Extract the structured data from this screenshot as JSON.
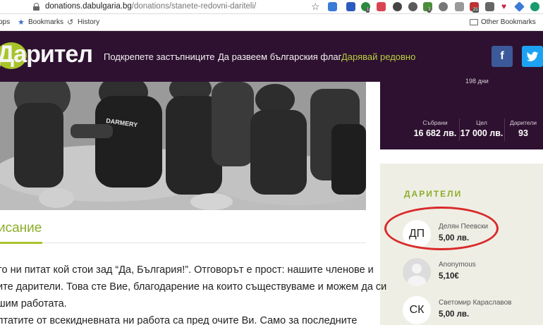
{
  "browser": {
    "url_domain": "donations.dabulgaria.bg",
    "url_path": "/donations/stanete-redovni-dariteli/",
    "extension_badges": [
      "1",
      "3",
      "21"
    ]
  },
  "bookmarks_bar": {
    "apps_label": "pps",
    "bookmarks_label": "Bookmarks",
    "history_label": "History",
    "other_bookmarks_label": "Other Bookmarks"
  },
  "site": {
    "logo_text": "Дарител",
    "nav": [
      {
        "label": "Подкрепете застъпниците"
      },
      {
        "label": "Да развеем българския флаг"
      },
      {
        "label": "Дарявай редовно"
      }
    ],
    "social": {
      "facebook_label": "f",
      "twitter_label": "t"
    },
    "colors": {
      "header_bg": "#2e1130",
      "accent": "#a8c42a",
      "panel_bg": "#efeee5",
      "highlight": "#d92a2a"
    }
  },
  "stats": {
    "days_text": "198 дни",
    "items": [
      {
        "label": "Събрани",
        "value": "16 682 лв."
      },
      {
        "label": "Цел",
        "value": "17 000 лв."
      },
      {
        "label": "Дарители",
        "value": "93"
      }
    ]
  },
  "donors": {
    "title": "ДАРИТЕЛИ",
    "items": [
      {
        "initials": "ДП",
        "name": "Делян Пеевски",
        "amount": "5,00 лв."
      },
      {
        "initials": "",
        "name": "Anonymous",
        "amount": "5,10€"
      },
      {
        "initials": "СК",
        "name": "Светомир Караславов",
        "amount": "5,00 лв."
      }
    ]
  },
  "hero": {
    "vest_text": "DARMERY"
  },
  "description": {
    "title": "исание",
    "lines": [
      "то ни питат кой стои зад “Да, България!”. Отговорът е прост: нашите членове и",
      "ите дарители. Това сте Вие, благодарение на които съществуваме и можем да си",
      "шим работата.",
      "лтатите от всекидневната ни работа са пред очите Ви. Само за последните"
    ]
  }
}
